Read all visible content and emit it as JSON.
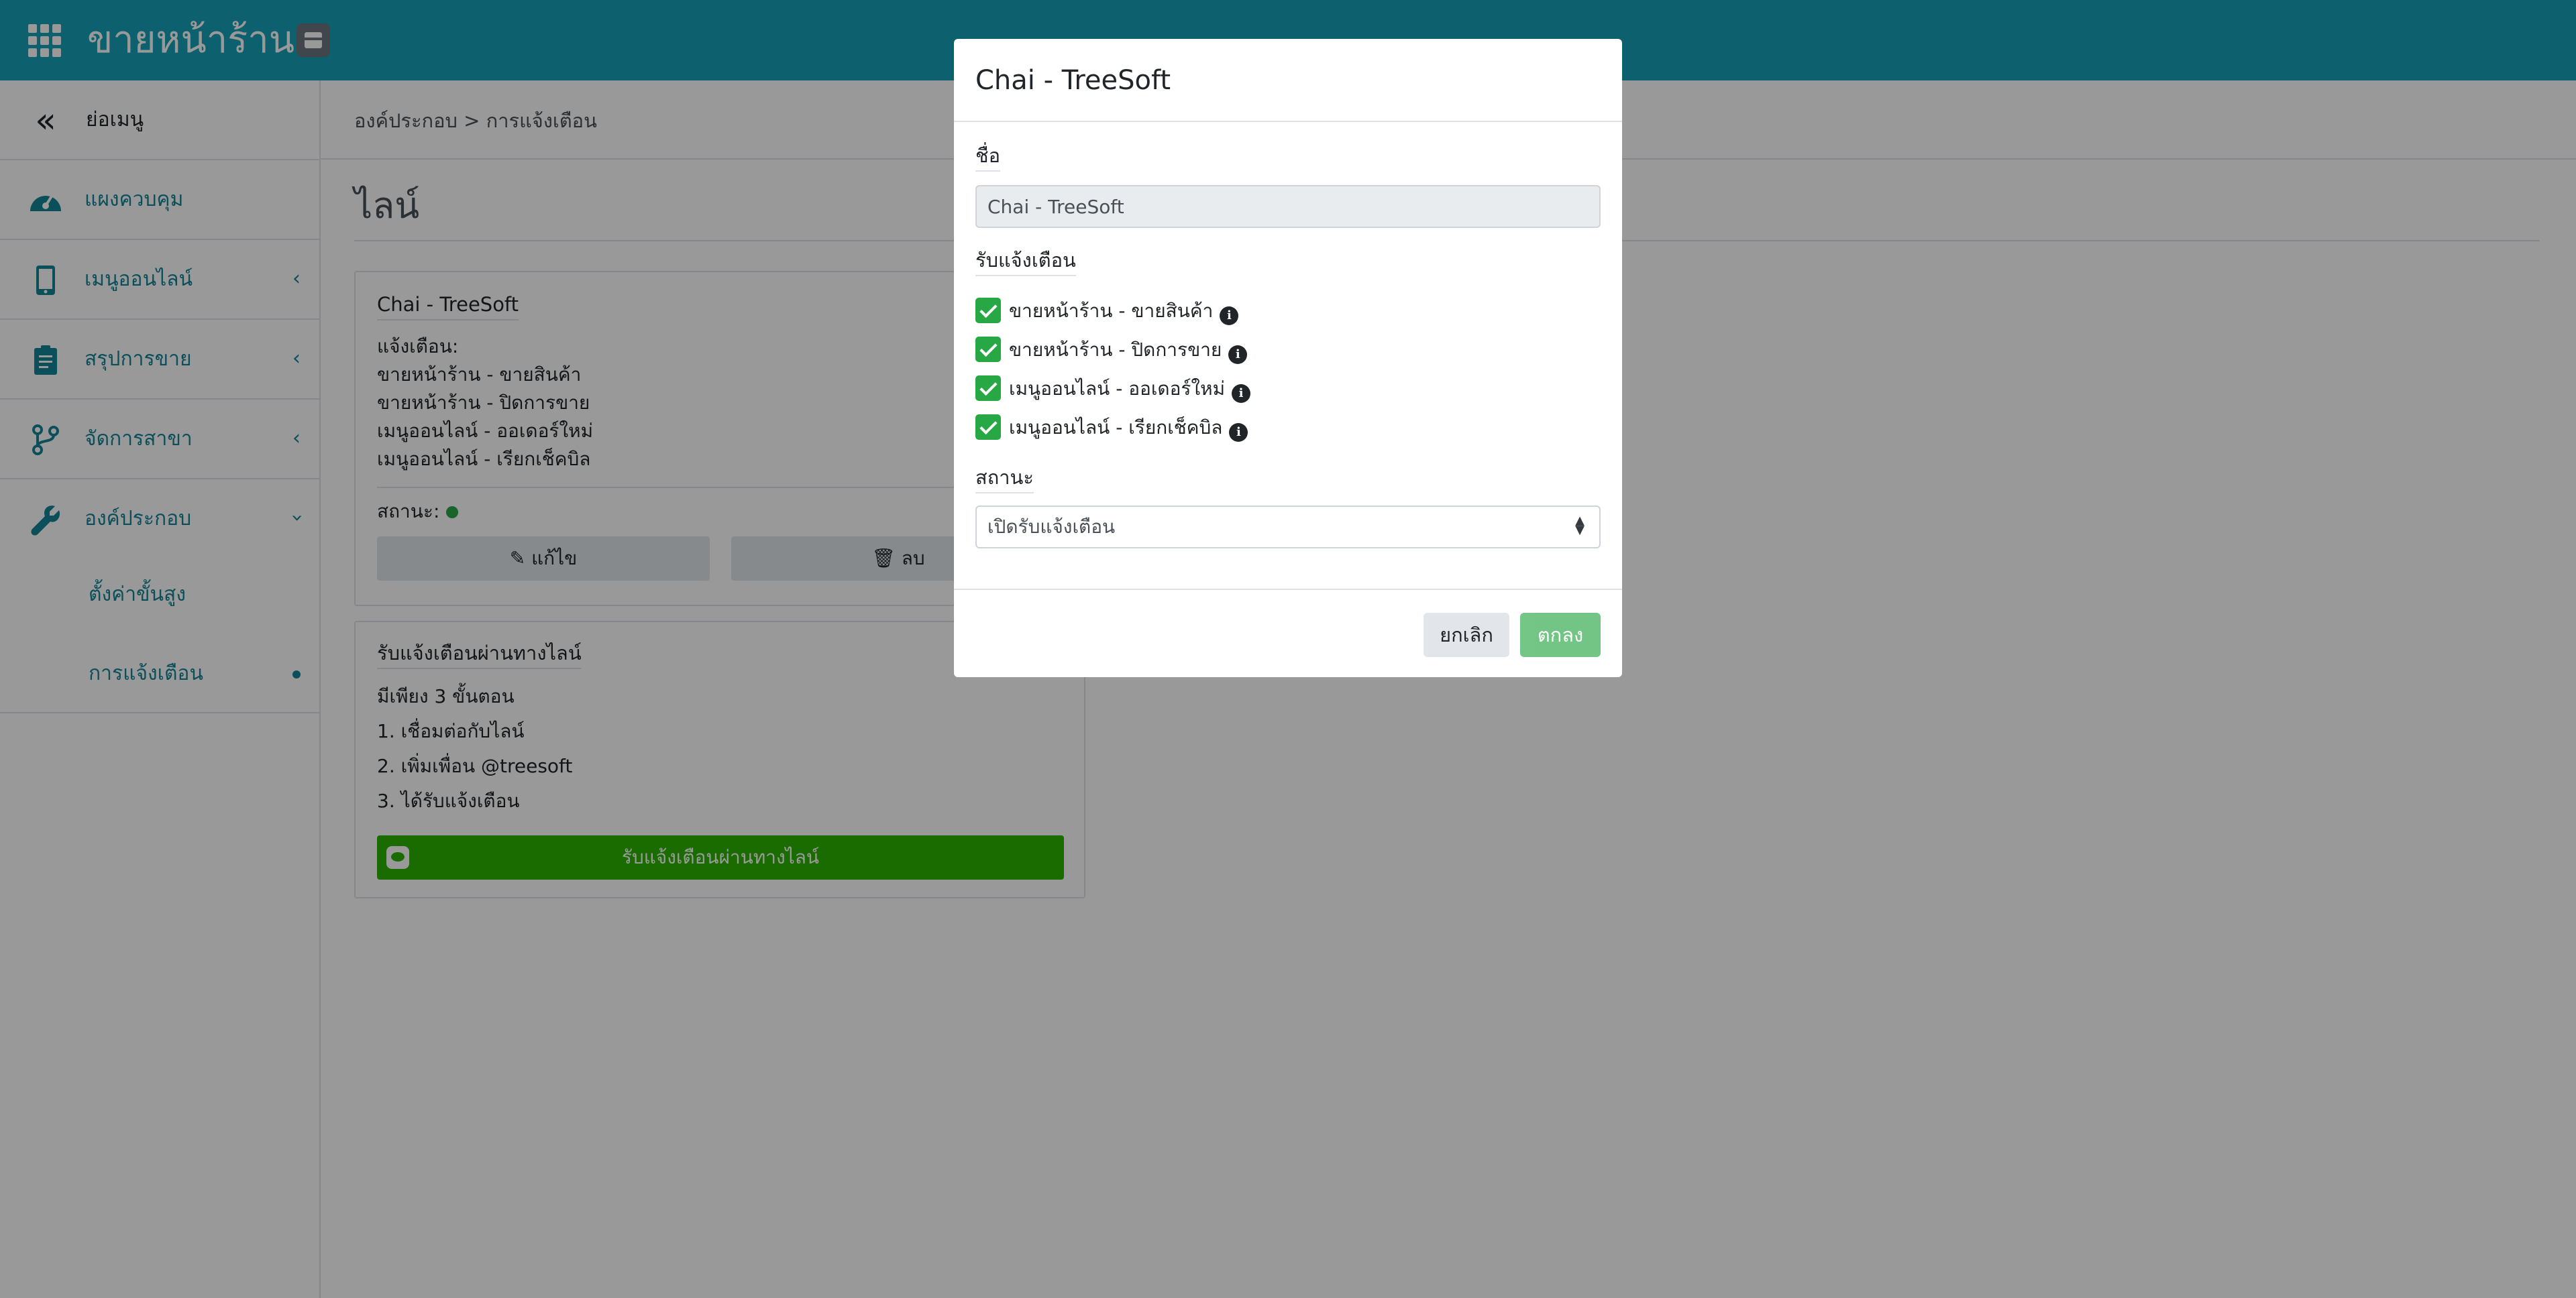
{
  "topbar": {
    "brand": "ขายหน้าร้าน",
    "apps_icon": "grid-icon",
    "store_icon": "store-icon"
  },
  "sidebar": {
    "items": [
      {
        "label": "ย่อเมนู",
        "icon": "double-chevron-left-icon"
      },
      {
        "label": "แผงควบคุม",
        "icon": "dashboard-icon"
      },
      {
        "label": "เมนูออนไลน์",
        "icon": "mobile-icon"
      },
      {
        "label": "สรุปการขาย",
        "icon": "clipboard-icon"
      },
      {
        "label": "จัดการสาขา",
        "icon": "branch-icon"
      },
      {
        "label": "องค์ประกอบ",
        "icon": "wrench-icon"
      }
    ],
    "sub_items": [
      {
        "label": "ตั้งค่าขั้นสูง"
      },
      {
        "label": "การแจ้งเตือน"
      }
    ]
  },
  "breadcrumb": "องค์ประกอบ > การแจ้งเตือน",
  "page_title": "ไลน์",
  "notification_card": {
    "title": "Chai - TreeSoft",
    "notify_label": "แจ้งเตือน:",
    "notifications": [
      "ขายหน้าร้าน - ขายสินค้า",
      "ขายหน้าร้าน - ปิดการขาย",
      "เมนูออนไลน์ - ออเดอร์ใหม่",
      "เมนูออนไลน์ - เรียกเช็คบิล"
    ],
    "status_label": "สถานะ:",
    "edit_label": "แก้ไข",
    "delete_label": "ลบ"
  },
  "line_card": {
    "title": "รับแจ้งเตือนผ่านทางไลน์",
    "steps": [
      "มีเพียง 3 ขั้นตอน",
      "1. เชื่อมต่อกับไลน์",
      "2. เพิ่มเพื่อน @treesoft",
      "3. ได้รับแจ้งเตือน"
    ],
    "button_label": "รับแจ้งเตือนผ่านทางไลน์"
  },
  "modal": {
    "title": "Chai - TreeSoft",
    "name_label": "ชื่อ",
    "name_value": "Chai - TreeSoft",
    "receive_label": "รับแจ้งเตือน",
    "options": [
      {
        "label": "ขายหน้าร้าน - ขายสินค้า",
        "checked": true
      },
      {
        "label": "ขายหน้าร้าน - ปิดการขาย",
        "checked": true
      },
      {
        "label": "เมนูออนไลน์ - ออเดอร์ใหม่",
        "checked": true
      },
      {
        "label": "เมนูออนไลน์ - เรียกเช็คบิล",
        "checked": true
      }
    ],
    "status_label": "สถานะ",
    "status_value": "เปิดรับแจ้งเตือน",
    "cancel_label": "ยกเลิก",
    "ok_label": "ตกลง"
  },
  "colors": {
    "primary": "#17a2b8",
    "success": "#28a745",
    "line_green": "#2db400"
  }
}
